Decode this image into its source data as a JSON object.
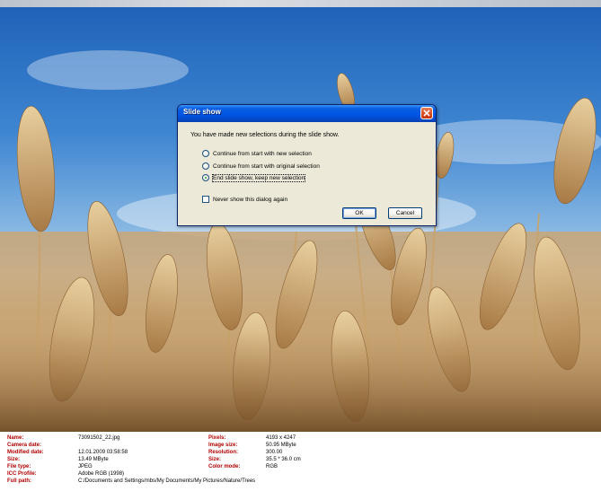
{
  "dialog": {
    "title": "Slide show",
    "message": "You have made new selections during the slide show.",
    "options": [
      {
        "label": "Continue from start with new selection",
        "checked": false
      },
      {
        "label": "Continue from start with original selection",
        "checked": false
      },
      {
        "label": "End slide show, keep new selection",
        "checked": true
      }
    ],
    "checkbox_label": "Never show this dialog again",
    "checkbox_checked": false,
    "ok_label": "OK",
    "cancel_label": "Cancel"
  },
  "info": {
    "left": [
      {
        "label": "Name:",
        "value": "73091502_22.jpg"
      },
      {
        "label": "Camera date:",
        "value": ""
      },
      {
        "label": "Modified date:",
        "value": "12.01.2009 03:58:58"
      },
      {
        "label": "Size:",
        "value": "13.49 MByte"
      },
      {
        "label": "File type:",
        "value": "JPEG"
      },
      {
        "label": "ICC Profile:",
        "value": "Adobe RGB (1998)"
      },
      {
        "label": "Full path:",
        "value": "C:/Documents and Settings/mbs/My Documents/My Pictures/Nature/Trees"
      }
    ],
    "right": [
      {
        "label": "Pixels:",
        "value": "4193 x 4247"
      },
      {
        "label": "Image size:",
        "value": "50.95 MByte"
      },
      {
        "label": "Resolution:",
        "value": "300.00"
      },
      {
        "label": "Size:",
        "value": "35.5 * 36.0 cm"
      },
      {
        "label": "Color mode:",
        "value": "RGB"
      }
    ]
  },
  "colors": {
    "label_red": "#b00000",
    "titlebar_blue": "#0055e5",
    "dialog_face": "#ece9d8"
  }
}
